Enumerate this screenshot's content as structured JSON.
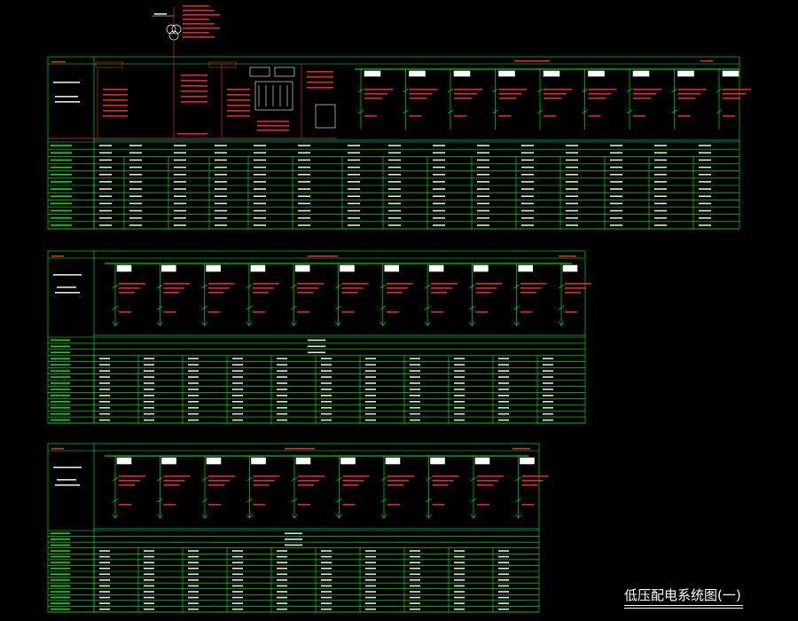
{
  "drawing_title": "低压配电系统图(一)",
  "colors": {
    "background": "#000000",
    "frame": "#00ff00",
    "circuit": "#ff2a2a",
    "label_box": "#ffffff",
    "busbar": "#00ffff",
    "title_text": "#ffffff"
  }
}
